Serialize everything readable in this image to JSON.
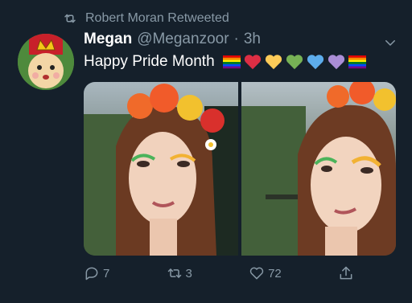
{
  "retweet_context": {
    "icon": "retweet-icon",
    "text": "Robert Moran Retweeted"
  },
  "author": {
    "display_name": "Megan",
    "handle": "@Meganzoor",
    "separator": "·",
    "time": "3h"
  },
  "tweet": {
    "text": "Happy Pride Month",
    "emoji": [
      "rainbow-flag",
      "red-heart",
      "yellow-heart",
      "green-heart",
      "blue-heart",
      "purple-heart",
      "rainbow-flag"
    ]
  },
  "media": {
    "count": 2
  },
  "actions": {
    "reply_count": "7",
    "retweet_count": "3",
    "like_count": "72",
    "share_label": ""
  },
  "colors": {
    "background": "#15202b",
    "muted": "#8899a6",
    "text": "#ffffff"
  }
}
